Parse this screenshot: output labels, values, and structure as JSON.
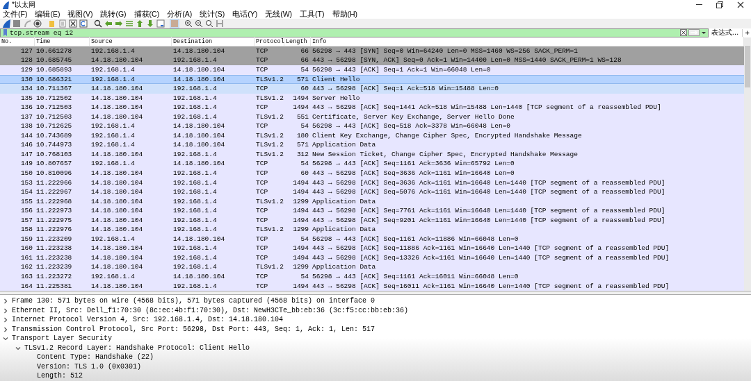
{
  "window": {
    "title": "*以太网"
  },
  "menu": [
    "文件(F)",
    "编辑(E)",
    "视图(V)",
    "跳转(G)",
    "捕获(C)",
    "分析(A)",
    "统计(S)",
    "电话(Y)",
    "无线(W)",
    "工具(T)",
    "帮助(H)"
  ],
  "filter": {
    "value": "tcp.stream eq 12",
    "expression_button": "表达式…",
    "add_button": "+"
  },
  "table": {
    "columns": [
      "No.",
      "Time",
      "Source",
      "Destination",
      "Protocol",
      "Length",
      "Info"
    ],
    "rows": [
      {
        "no": "127",
        "time": "10.661278",
        "source": "192.168.1.4",
        "destination": "14.18.180.104",
        "protocol": "TCP",
        "length": "66",
        "info": "56298 → 443 [SYN] Seq=0 Win=64240 Len=0 MSS=1460 WS=256 SACK_PERM=1",
        "color": "#a0a0a0",
        "selected": false
      },
      {
        "no": "128",
        "time": "10.685745",
        "source": "14.18.180.104",
        "destination": "192.168.1.4",
        "protocol": "TCP",
        "length": "66",
        "info": "443 → 56298 [SYN, ACK] Seq=0 Ack=1 Win=14400 Len=0 MSS=1440 SACK_PERM=1 WS=128",
        "color": "#a0a0a0",
        "selected": false
      },
      {
        "no": "129",
        "time": "10.685893",
        "source": "192.168.1.4",
        "destination": "14.18.180.104",
        "protocol": "TCP",
        "length": "54",
        "info": "56298 → 443 [ACK] Seq=1 Ack=1 Win=66048 Len=0",
        "color": "#e7e6ff",
        "selected": false
      },
      {
        "no": "130",
        "time": "10.686321",
        "source": "192.168.1.4",
        "destination": "14.18.180.104",
        "protocol": "TLSv1.2",
        "length": "571",
        "info": "Client Hello",
        "color": "#b5d3ff",
        "selected": true
      },
      {
        "no": "134",
        "time": "10.711367",
        "source": "14.18.180.104",
        "destination": "192.168.1.4",
        "protocol": "TCP",
        "length": "60",
        "info": "443 → 56298 [ACK] Seq=1 Ack=518 Win=15488 Len=0",
        "color": "#cfe1fb",
        "selected": false
      },
      {
        "no": "135",
        "time": "10.712502",
        "source": "14.18.180.104",
        "destination": "192.168.1.4",
        "protocol": "TLSv1.2",
        "length": "1494",
        "info": "Server Hello",
        "color": "#e7e6ff",
        "selected": false
      },
      {
        "no": "136",
        "time": "10.712503",
        "source": "14.18.180.104",
        "destination": "192.168.1.4",
        "protocol": "TCP",
        "length": "1494",
        "info": "443 → 56298 [ACK] Seq=1441 Ack=518 Win=15488 Len=1440 [TCP segment of a reassembled PDU]",
        "color": "#e7e6ff",
        "selected": false
      },
      {
        "no": "137",
        "time": "10.712503",
        "source": "14.18.180.104",
        "destination": "192.168.1.4",
        "protocol": "TLSv1.2",
        "length": "551",
        "info": "Certificate, Server Key Exchange, Server Hello Done",
        "color": "#e7e6ff",
        "selected": false
      },
      {
        "no": "138",
        "time": "10.712625",
        "source": "192.168.1.4",
        "destination": "14.18.180.104",
        "protocol": "TCP",
        "length": "54",
        "info": "56298 → 443 [ACK] Seq=518 Ack=3378 Win=66048 Len=0",
        "color": "#e7e6ff",
        "selected": false
      },
      {
        "no": "144",
        "time": "10.743689",
        "source": "192.168.1.4",
        "destination": "14.18.180.104",
        "protocol": "TLSv1.2",
        "length": "180",
        "info": "Client Key Exchange, Change Cipher Spec, Encrypted Handshake Message",
        "color": "#e7e6ff",
        "selected": false
      },
      {
        "no": "146",
        "time": "10.744973",
        "source": "192.168.1.4",
        "destination": "14.18.180.104",
        "protocol": "TLSv1.2",
        "length": "571",
        "info": "Application Data",
        "color": "#e7e6ff",
        "selected": false
      },
      {
        "no": "147",
        "time": "10.768103",
        "source": "14.18.180.104",
        "destination": "192.168.1.4",
        "protocol": "TLSv1.2",
        "length": "312",
        "info": "New Session Ticket, Change Cipher Spec, Encrypted Handshake Message",
        "color": "#e7e6ff",
        "selected": false
      },
      {
        "no": "149",
        "time": "10.807657",
        "source": "192.168.1.4",
        "destination": "14.18.180.104",
        "protocol": "TCP",
        "length": "54",
        "info": "56298 → 443 [ACK] Seq=1161 Ack=3636 Win=65792 Len=0",
        "color": "#e7e6ff",
        "selected": false
      },
      {
        "no": "150",
        "time": "10.810096",
        "source": "14.18.180.104",
        "destination": "192.168.1.4",
        "protocol": "TCP",
        "length": "60",
        "info": "443 → 56298 [ACK] Seq=3636 Ack=1161 Win=16640 Len=0",
        "color": "#e7e6ff",
        "selected": false
      },
      {
        "no": "153",
        "time": "11.222966",
        "source": "14.18.180.104",
        "destination": "192.168.1.4",
        "protocol": "TCP",
        "length": "1494",
        "info": "443 → 56298 [ACK] Seq=3636 Ack=1161 Win=16640 Len=1440 [TCP segment of a reassembled PDU]",
        "color": "#e7e6ff",
        "selected": false
      },
      {
        "no": "154",
        "time": "11.222967",
        "source": "14.18.180.104",
        "destination": "192.168.1.4",
        "protocol": "TCP",
        "length": "1494",
        "info": "443 → 56298 [ACK] Seq=5076 Ack=1161 Win=16640 Len=1440 [TCP segment of a reassembled PDU]",
        "color": "#e7e6ff",
        "selected": false
      },
      {
        "no": "155",
        "time": "11.222968",
        "source": "14.18.180.104",
        "destination": "192.168.1.4",
        "protocol": "TLSv1.2",
        "length": "1299",
        "info": "Application Data",
        "color": "#e7e6ff",
        "selected": false
      },
      {
        "no": "156",
        "time": "11.222973",
        "source": "14.18.180.104",
        "destination": "192.168.1.4",
        "protocol": "TCP",
        "length": "1494",
        "info": "443 → 56298 [ACK] Seq=7761 Ack=1161 Win=16640 Len=1440 [TCP segment of a reassembled PDU]",
        "color": "#e7e6ff",
        "selected": false
      },
      {
        "no": "157",
        "time": "11.222975",
        "source": "14.18.180.104",
        "destination": "192.168.1.4",
        "protocol": "TCP",
        "length": "1494",
        "info": "443 → 56298 [ACK] Seq=9201 Ack=1161 Win=16640 Len=1440 [TCP segment of a reassembled PDU]",
        "color": "#e7e6ff",
        "selected": false
      },
      {
        "no": "158",
        "time": "11.222976",
        "source": "14.18.180.104",
        "destination": "192.168.1.4",
        "protocol": "TLSv1.2",
        "length": "1299",
        "info": "Application Data",
        "color": "#e7e6ff",
        "selected": false
      },
      {
        "no": "159",
        "time": "11.223209",
        "source": "192.168.1.4",
        "destination": "14.18.180.104",
        "protocol": "TCP",
        "length": "54",
        "info": "56298 → 443 [ACK] Seq=1161 Ack=11886 Win=66048 Len=0",
        "color": "#e7e6ff",
        "selected": false
      },
      {
        "no": "160",
        "time": "11.223238",
        "source": "14.18.180.104",
        "destination": "192.168.1.4",
        "protocol": "TCP",
        "length": "1494",
        "info": "443 → 56298 [ACK] Seq=11886 Ack=1161 Win=16640 Len=1440 [TCP segment of a reassembled PDU]",
        "color": "#e7e6ff",
        "selected": false
      },
      {
        "no": "161",
        "time": "11.223238",
        "source": "14.18.180.104",
        "destination": "192.168.1.4",
        "protocol": "TCP",
        "length": "1494",
        "info": "443 → 56298 [ACK] Seq=13326 Ack=1161 Win=16640 Len=1440 [TCP segment of a reassembled PDU]",
        "color": "#e7e6ff",
        "selected": false
      },
      {
        "no": "162",
        "time": "11.223239",
        "source": "14.18.180.104",
        "destination": "192.168.1.4",
        "protocol": "TLSv1.2",
        "length": "1299",
        "info": "Application Data",
        "color": "#e7e6ff",
        "selected": false
      },
      {
        "no": "163",
        "time": "11.223272",
        "source": "192.168.1.4",
        "destination": "14.18.180.104",
        "protocol": "TCP",
        "length": "54",
        "info": "56298 → 443 [ACK] Seq=1161 Ack=16011 Win=66048 Len=0",
        "color": "#e7e6ff",
        "selected": false
      },
      {
        "no": "164",
        "time": "11.225381",
        "source": "14.18.180.104",
        "destination": "192.168.1.4",
        "protocol": "TCP",
        "length": "1494",
        "info": "443 → 56298 [ACK] Seq=16011 Ack=1161 Win=16640 Len=1440 [TCP segment of a reassembled PDU]",
        "color": "#e7e6ff",
        "selected": false
      }
    ]
  },
  "details": [
    {
      "text": "Frame 130: 571 bytes on wire (4568 bits), 571 bytes captured (4568 bits) on interface 0",
      "expanded": false
    },
    {
      "text": "Ethernet II, Src: Dell_f1:70:30 (8c:ec:4b:f1:70:30), Dst: NewH3CTe_bb:eb:36 (3c:f5:cc:bb:eb:36)",
      "expanded": false
    },
    {
      "text": "Internet Protocol Version 4, Src: 192.168.1.4, Dst: 14.18.180.104",
      "expanded": false
    },
    {
      "text": "Transmission Control Protocol, Src Port: 56298, Dst Port: 443, Seq: 1, Ack: 1, Len: 517",
      "expanded": false
    },
    {
      "text": "Transport Layer Security",
      "expanded": true,
      "children": [
        {
          "text": "TLSv1.2 Record Layer: Handshake Protocol: Client Hello",
          "expanded": true,
          "children": [
            {
              "text": "Content Type: Handshake (22)"
            },
            {
              "text": "Version: TLS 1.0 (0x0301)"
            },
            {
              "text": "Length: 512"
            }
          ]
        }
      ]
    }
  ]
}
